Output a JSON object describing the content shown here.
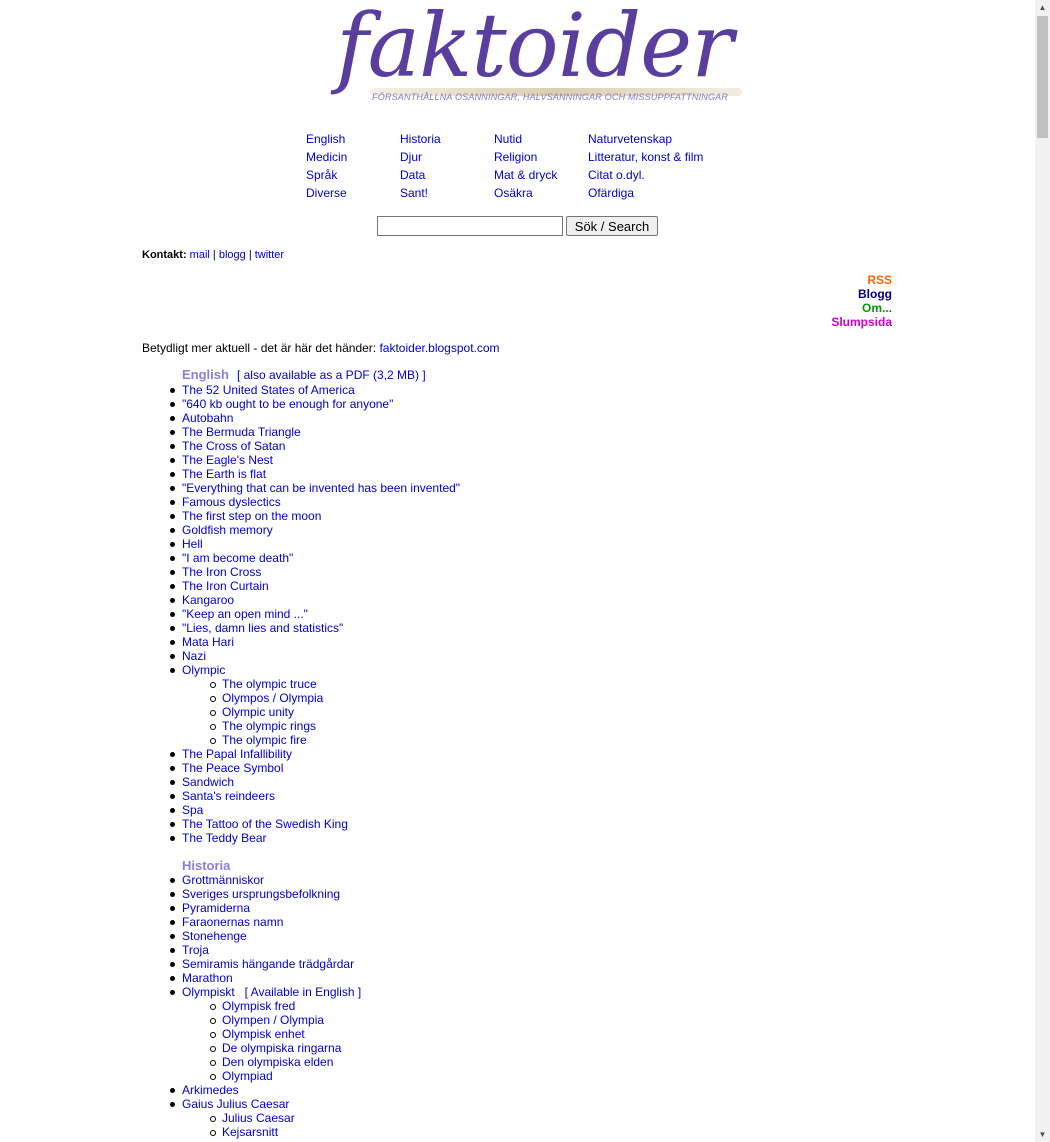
{
  "logo": {
    "word": "faktoider",
    "tagline": "FÖRSANTHÅLLNA OSANNINGAR, HALVSANNINGAR OCH MISSUPPFATTNINGAR"
  },
  "nav": [
    [
      "English",
      "Historia",
      "Nutid",
      "Naturvetenskap"
    ],
    [
      "Medicin",
      "Djur",
      "Religion",
      "Litteratur, konst & film"
    ],
    [
      "Språk",
      "Data",
      "Mat & dryck",
      "Citat o.dyl."
    ],
    [
      "Diverse",
      "Sant!",
      "Osäkra",
      "Ofärdiga"
    ]
  ],
  "search": {
    "value": "",
    "button_label": "Sök / Search"
  },
  "kontakt": {
    "label": "Kontakt:",
    "mail": "mail",
    "sep": "|",
    "blogg": "blogg",
    "twitter": "twitter"
  },
  "side_links": [
    {
      "label": "RSS",
      "color": "#ff6600"
    },
    {
      "label": "Blogg",
      "color": "#000080"
    },
    {
      "label": "Om...",
      "color": "#009900"
    },
    {
      "label": "Slumpsida",
      "color": "#cc00cc"
    }
  ],
  "blog_note": {
    "text": "Betydligt mer aktuell - det är här det händer: ",
    "link": "faktoider.blogspot.com"
  },
  "sections": [
    {
      "title": "English",
      "aux": "[ also available as a PDF (3,2 MB) ]",
      "items": [
        {
          "label": "The 52 United States of America"
        },
        {
          "label": "\"640 kb ought to be enough for anyone\""
        },
        {
          "label": "Autobahn"
        },
        {
          "label": "The Bermuda Triangle"
        },
        {
          "label": "The Cross of Satan"
        },
        {
          "label": "The Eagle's Nest"
        },
        {
          "label": "The Earth is flat"
        },
        {
          "label": "\"Everything that can be invented has been invented\""
        },
        {
          "label": "Famous dyslectics"
        },
        {
          "label": "The first step on the moon"
        },
        {
          "label": "Goldfish memory"
        },
        {
          "label": "Hell"
        },
        {
          "label": "\"I am become death\""
        },
        {
          "label": "The Iron Cross"
        },
        {
          "label": "The Iron Curtain"
        },
        {
          "label": "Kangaroo"
        },
        {
          "label": "\"Keep an open mind ...\""
        },
        {
          "label": "\"Lies, damn lies and statistics\""
        },
        {
          "label": "Mata Hari"
        },
        {
          "label": "Nazi"
        },
        {
          "label": "Olympic",
          "children": [
            "The olympic truce",
            "Olympos / Olympia",
            "Olympic unity",
            "The olympic rings",
            "The olympic fire"
          ]
        },
        {
          "label": "The Papal Infallibility"
        },
        {
          "label": "The Peace Symbol"
        },
        {
          "label": "Sandwich"
        },
        {
          "label": "Santa's reindeers"
        },
        {
          "label": "Spa"
        },
        {
          "label": "The Tattoo of the Swedish King"
        },
        {
          "label": "The Teddy Bear"
        }
      ]
    },
    {
      "title": "Historia",
      "aux": "",
      "items": [
        {
          "label": "Grottmänniskor"
        },
        {
          "label": "Sveriges ursprungsbefolkning"
        },
        {
          "label": "Pyramiderna"
        },
        {
          "label": "Faraonernas namn"
        },
        {
          "label": "Stonehenge"
        },
        {
          "label": "Troja"
        },
        {
          "label": "Semiramis hängande trädgårdar"
        },
        {
          "label": "Marathon"
        },
        {
          "label": "Olympiskt",
          "aux": "[ Available in English ]",
          "children": [
            "Olympisk fred",
            "Olympen / Olympia",
            "Olympisk enhet",
            "De olympiska ringarna",
            "Den olympiska elden",
            "Olympiad"
          ]
        },
        {
          "label": "Arkimedes"
        },
        {
          "label": "Gaius Julius Caesar",
          "children": [
            "Julius Caesar",
            "Kejsarsnitt"
          ]
        }
      ]
    }
  ]
}
